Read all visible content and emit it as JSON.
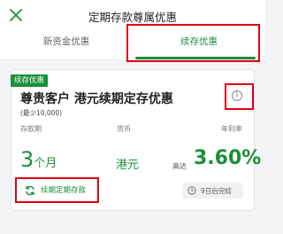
{
  "header": {
    "title": "定期存款尊属优惠",
    "close_icon": "close-icon"
  },
  "tabs": [
    {
      "label": "新资金优惠",
      "active": false
    },
    {
      "label": "续存优惠",
      "active": true
    }
  ],
  "offer": {
    "badge": "续存优惠",
    "title": "尊贵客户 港元续期定存优惠",
    "min_amount": "(最少10,000)",
    "info_icon": "info-icon",
    "columns": {
      "period": "存款期",
      "currency": "货币",
      "rate": "年利率"
    },
    "period_number": "3",
    "period_unit": "个月",
    "currency": "港元",
    "rate_prefix": "高达",
    "rate": "3.60%",
    "renew_button": "续期定期存款",
    "renew_icon": "refresh-icon",
    "countdown": "9日后完结",
    "countdown_icon": "clock-icon"
  },
  "colors": {
    "accent": "#1a8f3a",
    "highlight": "#e00012"
  }
}
